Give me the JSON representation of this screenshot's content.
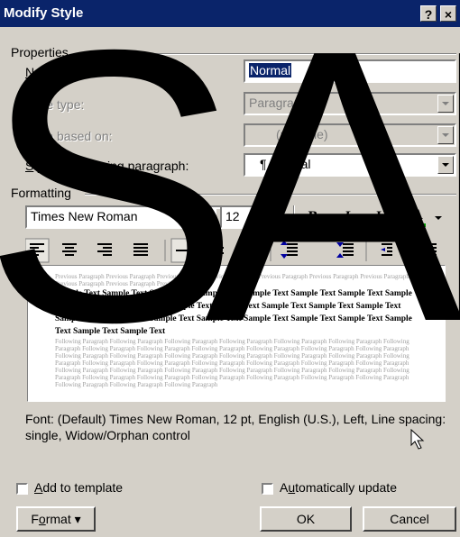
{
  "window": {
    "title": "Modify Style",
    "help_btn": "?",
    "close_btn": "×"
  },
  "properties": {
    "header": "Properties",
    "name_label_u": "N",
    "name_label_rest": "ame:",
    "name_value": "Normal",
    "style_type_label": "Style type:",
    "style_type_value": "Paragraph",
    "based_on_label": "Style based on:",
    "based_on_value": "(no style)",
    "following_label_u": "S",
    "following_label_rest": "tyle for following paragraph:",
    "following_value": "¶ Normal"
  },
  "formatting": {
    "header": "Formatting",
    "font": "Times New Roman",
    "size": "12",
    "bold": "B",
    "italic": "I",
    "underline": "U",
    "font_color": "A"
  },
  "preview": {
    "previous": "Previous Paragraph Previous Paragraph Previous Paragraph Previous Paragraph Previous Paragraph Previous Paragraph Previous Paragraph Previous Paragraph Previous Paragraph Previous Paragraph",
    "sample": "Sample Text Sample Text Sample Text Sample Text Sample Text Sample Text Sample Text Sample Text Sample Text Sample Text Sample Text Sample Text Sample Text Sample Text Sample Text Sample Text Sample Text Sample Text Sample Text Sample Text Sample Text Sample Text Sample Text Sample Text Sample Text",
    "following": "Following Paragraph Following Paragraph Following Paragraph Following Paragraph Following Paragraph Following Paragraph Following Paragraph Following Paragraph Following Paragraph Following Paragraph Following Paragraph Following Paragraph Following Paragraph Following Paragraph Following Paragraph Following Paragraph Following Paragraph Following Paragraph Following Paragraph Following Paragraph Following Paragraph Following Paragraph Following Paragraph Following Paragraph Following Paragraph Following Paragraph Following Paragraph Following Paragraph Following Paragraph Following Paragraph Following Paragraph Following Paragraph Following Paragraph Following Paragraph Following Paragraph Following Paragraph Following Paragraph Following Paragraph Following Paragraph Following Paragraph Following Paragraph Following Paragraph"
  },
  "description": "Font: (Default) Times New Roman, 12 pt, English (U.S.), Left, Line spacing:  single, Widow/Orphan control",
  "options": {
    "add_to_template_u": "A",
    "add_to_template_rest": "dd to template",
    "auto_update_pre": "A",
    "auto_update_u": "u",
    "auto_update_rest": "tomatically update"
  },
  "buttons": {
    "format_pre": "F",
    "format_u": "o",
    "format_rest": "rmat ▾",
    "ok": "OK",
    "cancel": "Cancel"
  },
  "watermark": "SAM",
  "colors": {
    "titlebar": "#0a246a",
    "dialog_bg": "#d4d0c8",
    "font_color_bar": "#00a000"
  }
}
